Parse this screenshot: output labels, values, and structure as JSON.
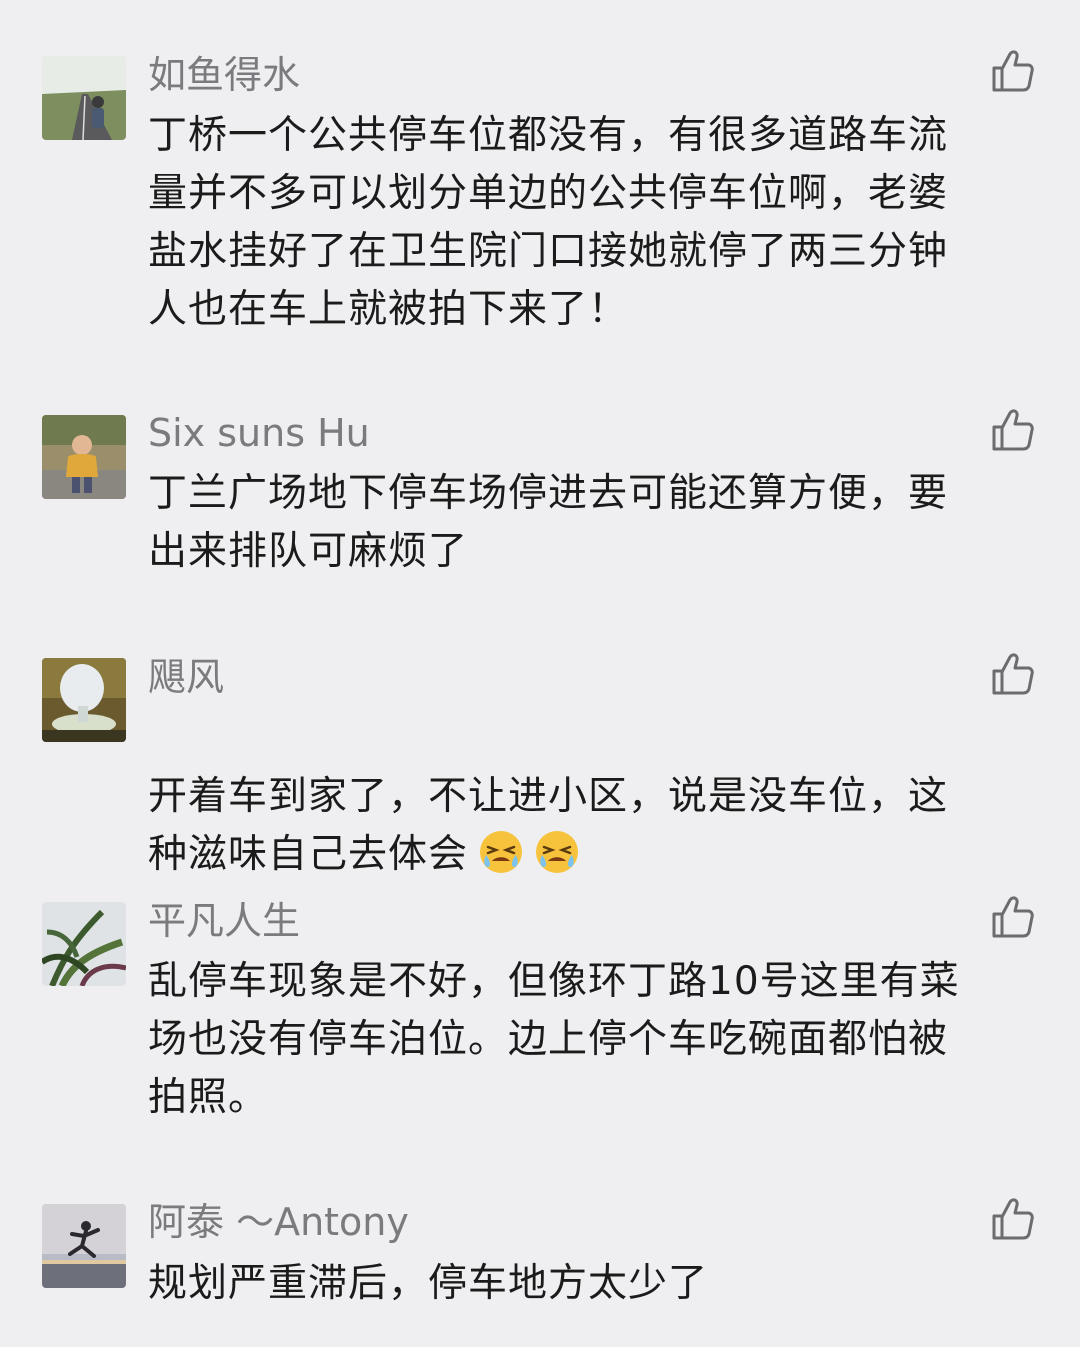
{
  "comments": [
    {
      "nickname": "如鱼得水",
      "avatar_icon": "road-photo-avatar",
      "like_icon": "thumbs-up-icon",
      "text": "丁桥一个公共停车位都没有，有很多道路车流\n量并不多可以划分单边的公共停车位啊，老婆\n盐水挂好了在卫生院门口接她就停了两三分钟\n人也在车上就被拍下来了！"
    },
    {
      "nickname": "Six suns Hu",
      "avatar_icon": "child-photo-avatar",
      "like_icon": "thumbs-up-icon",
      "text": "丁兰广场地下停车场停进去可能还算方便，要\n出来排队可麻烦了"
    },
    {
      "nickname": "飓风",
      "avatar_icon": "sculpture-photo-avatar",
      "like_icon": "thumbs-up-icon",
      "text": "开着车到家了，不让进小区，说是没车位，这\n种滋味自己去体会",
      "emojis": [
        "crying-face-emoji",
        "crying-face-emoji"
      ]
    },
    {
      "nickname": "平凡人生",
      "avatar_icon": "plant-photo-avatar",
      "like_icon": "thumbs-up-icon",
      "text": "乱停车现象是不好，但像环丁路10号这里有菜\n场也没有停车泊位。边上停个车吃碗面都怕被\n拍照。"
    },
    {
      "nickname": "阿泰 ～Antony",
      "avatar_icon": "silhouette-photo-avatar",
      "like_icon": "thumbs-up-icon",
      "text": "规划严重滞后，停车地方太少了"
    }
  ],
  "colors": {
    "background": "#efeff1",
    "nickname": "#7a7a7f",
    "content": "#1b1b1b",
    "like_icon": "#6b6b70"
  }
}
